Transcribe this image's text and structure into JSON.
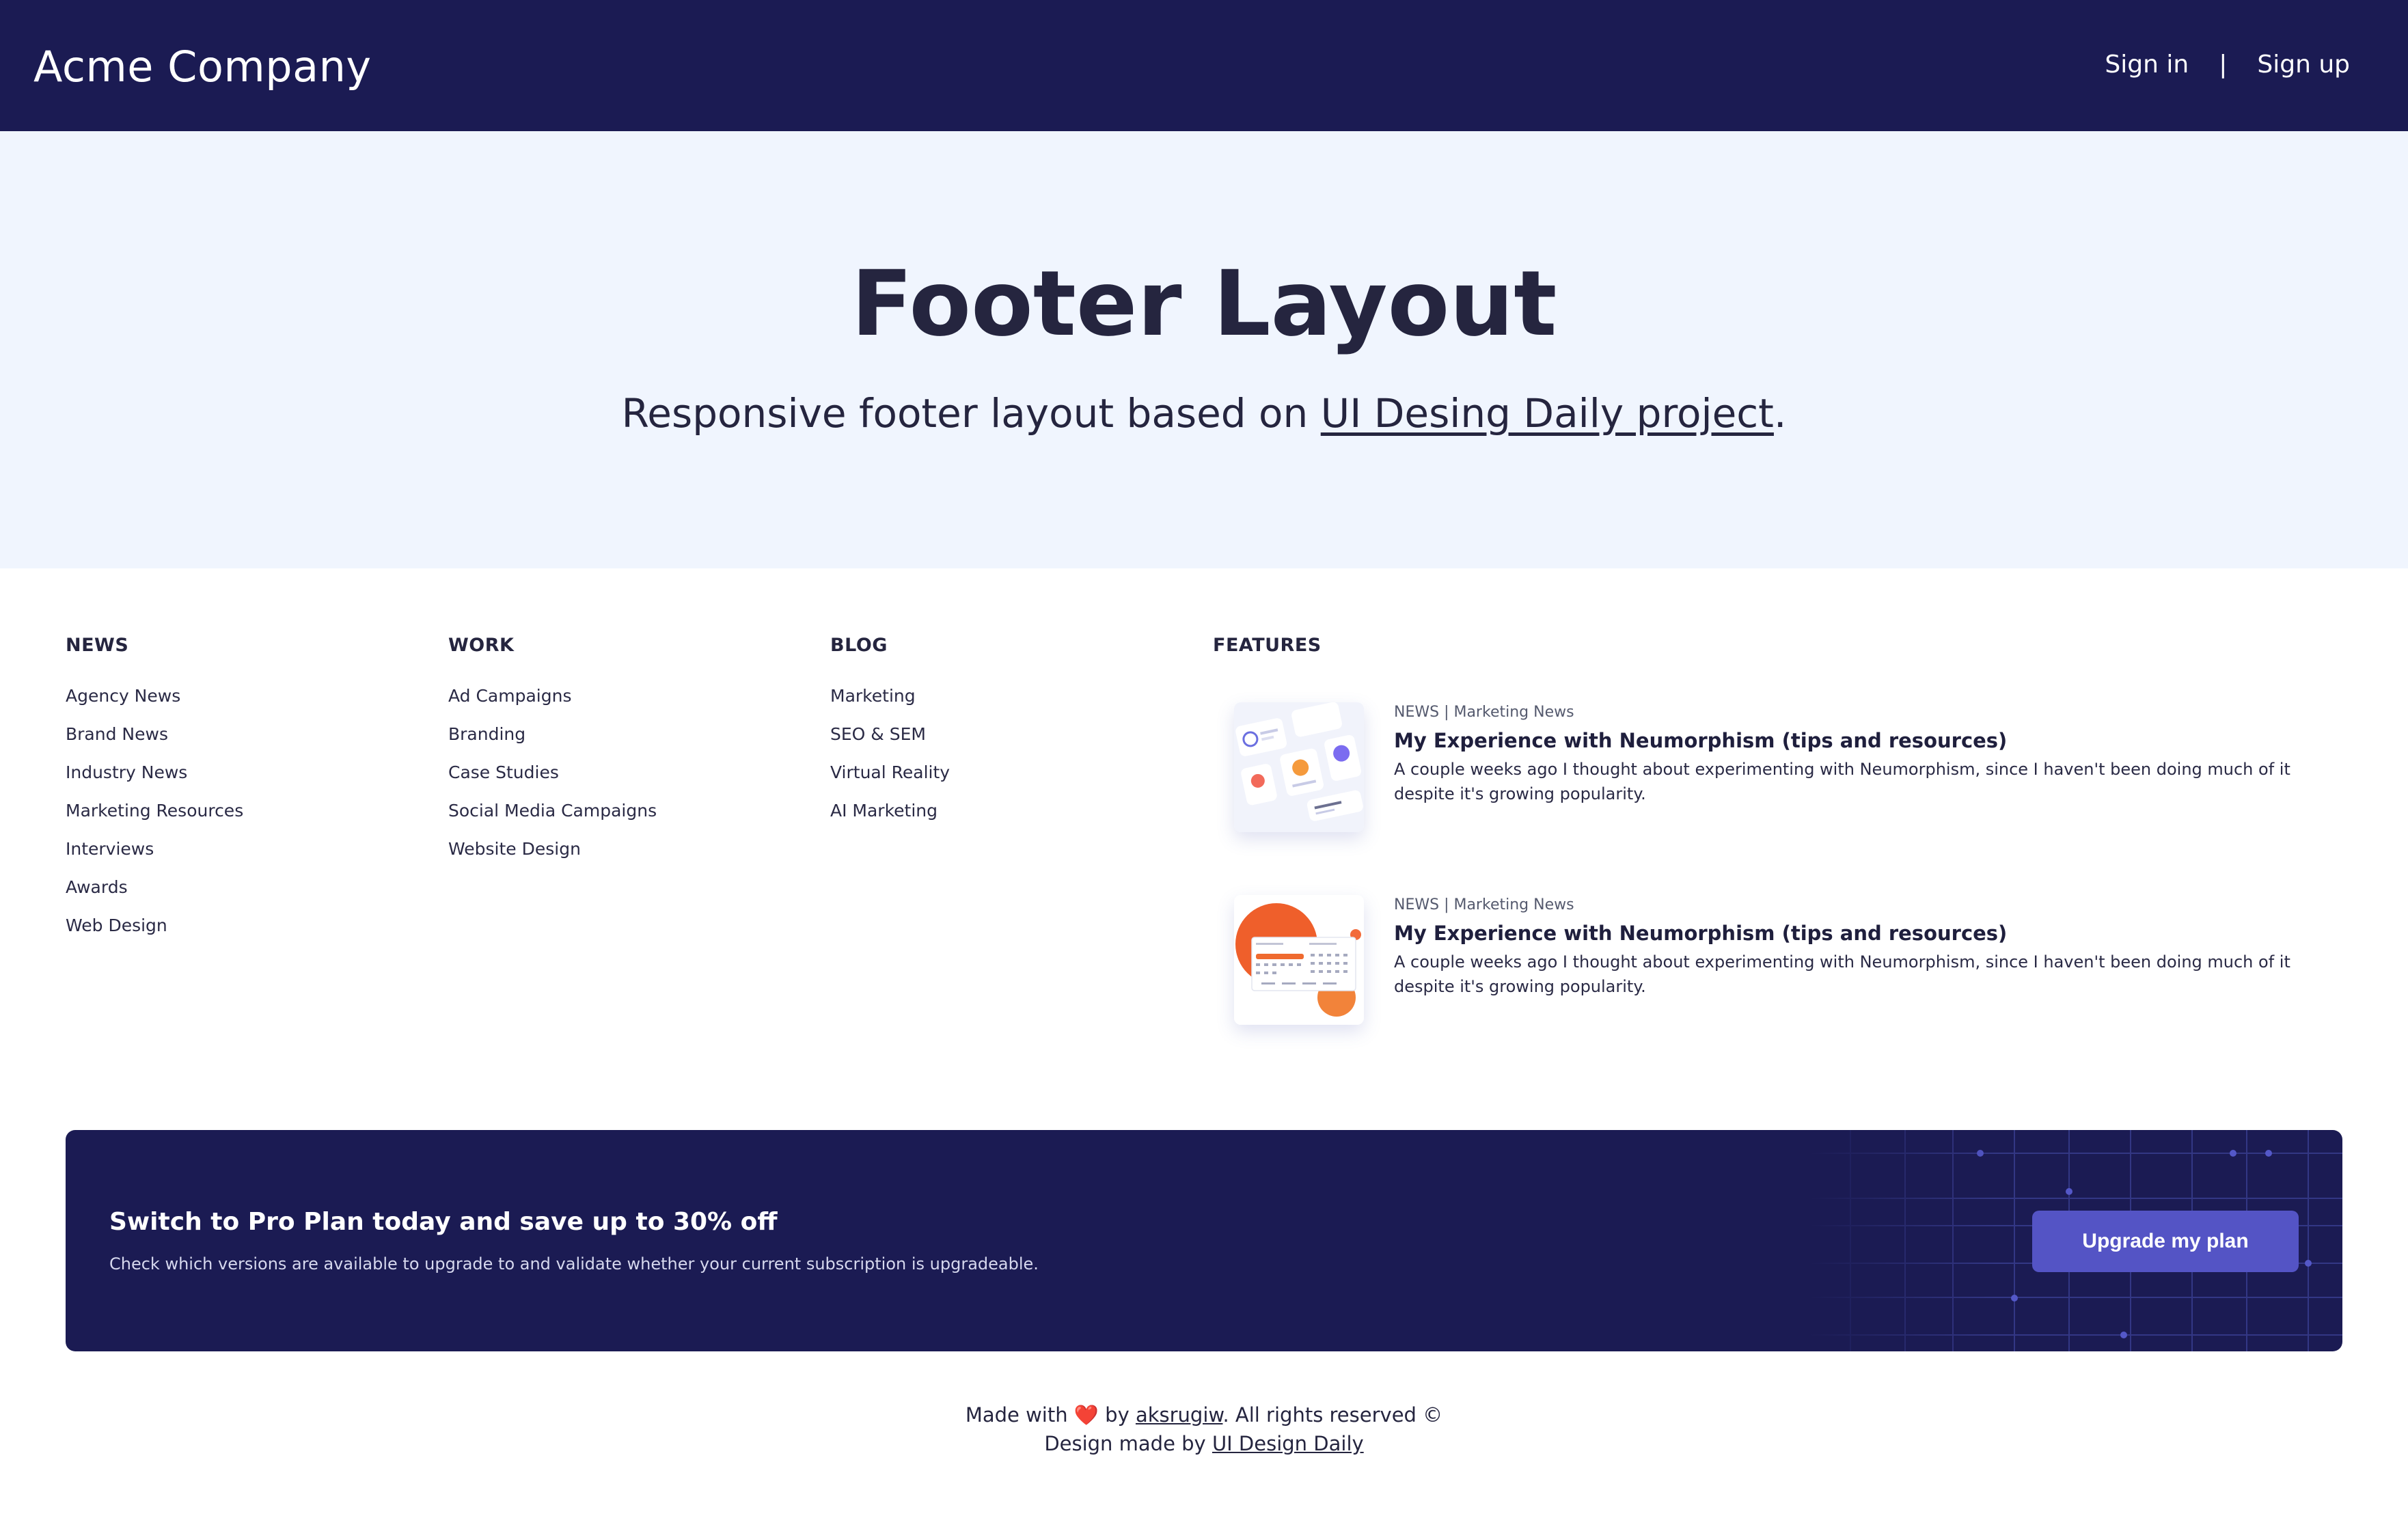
{
  "header": {
    "brand": "Acme Company",
    "sign_in": "Sign in",
    "separator": "|",
    "sign_up": "Sign up",
    "background_color": "#1b1b53"
  },
  "hero": {
    "title": "Footer Layout",
    "subtitle_prefix": "Responsive footer layout based on ",
    "subtitle_link": "UI Desing Daily project",
    "subtitle_suffix": ".",
    "background_color": "#f0f5fe"
  },
  "columns": [
    {
      "heading": "NEWS",
      "items": [
        "Agency News",
        "Brand News",
        "Industry News",
        "Marketing Resources",
        "Interviews",
        "Awards",
        "Web Design"
      ]
    },
    {
      "heading": "WORK",
      "items": [
        "Ad Campaigns",
        "Branding",
        "Case Studies",
        "Social Media Campaigns",
        "Website Design"
      ]
    },
    {
      "heading": "BLOG",
      "items": [
        "Marketing",
        "SEO & SEM",
        "Virtual Reality",
        "AI Marketing"
      ]
    }
  ],
  "features": {
    "heading": "FEATURES",
    "items": [
      {
        "meta": "NEWS | Marketing News",
        "title": "My Experience with Neumorphism (tips and resources)",
        "description": "A couple weeks ago I thought about experimenting with Neumorphism, since I haven't been doing much of it despite it's growing popularity.",
        "thumbnail_icon": "neumorphism-dashboard-thumbnail"
      },
      {
        "meta": "NEWS | Marketing News",
        "title": "My Experience with Neumorphism (tips and resources)",
        "description": "A couple weeks ago I thought about experimenting with Neumorphism, since I haven't been doing much of it despite it's growing popularity.",
        "thumbnail_icon": "calendar-ui-thumbnail"
      }
    ]
  },
  "promo": {
    "title": "Switch to Pro Plan today and save up to 30% off",
    "text": "Check which versions are available to upgrade to and validate whether your current subscription is upgradeable.",
    "button_label": "Upgrade my plan",
    "button_color": "#5454c5"
  },
  "credits": {
    "made_with": "Made with",
    "heart_icon": "heart-icon",
    "by": "by",
    "author": "aksrugiw",
    "rights": ". All rights reserved ©",
    "design_prefix": "Design made by",
    "design_link": "UI Design Daily"
  }
}
